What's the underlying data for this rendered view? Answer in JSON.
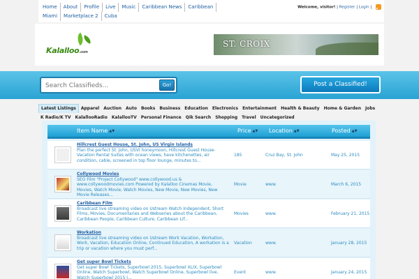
{
  "topnav": {
    "items": [
      "Home",
      "About",
      "Profile",
      "Live",
      "Music",
      "Caribbean News",
      "Caribbean",
      "Miami",
      "Marketplace 2",
      "Cuba"
    ]
  },
  "account": {
    "welcome": "Welcome, visitor!",
    "register": "Register",
    "login": "Login"
  },
  "header": {
    "logo_text": "Kalalloo",
    "logo_suffix": ".com",
    "banner_text": "ST. CROIX"
  },
  "search": {
    "placeholder": "Search Classifieds...",
    "go_label": "Go!",
    "post_label": "Post a Classified!"
  },
  "tabs": {
    "row1": [
      "Latest Listings",
      "Apparel",
      "Auction",
      "Auto",
      "Books",
      "Business",
      "Education",
      "Electronics",
      "Entertainment",
      "Health & Beauty",
      "Home & Garden",
      "Jobs"
    ],
    "row2": [
      "K Radio/K TV",
      "KalallooRadio",
      "KalallooTV",
      "Personal Finance",
      "Qik Search",
      "Shopping",
      "Travel",
      "Uncategorized"
    ]
  },
  "table": {
    "headers": {
      "name": "Item Name",
      "price": "Price",
      "location": "Location",
      "posted": "Posted"
    },
    "rows": [
      {
        "title": "Hillcrest Guest House, St. John, US Virgin Islands",
        "desc": "Plan the perfect St. John, USVI honeymoon, Hillcrest Guest House- Vacation Rental Suites with ocean views, have kitchenettes, air condition, cable, screened in top floor lounge, minutes to...",
        "price": "185",
        "location": "Cruz Bay, St. John",
        "posted": "May 25, 2015"
      },
      {
        "title": "Collywood Movies",
        "desc": "SEO Film \"Project Collywood\" www.collywood.us & www.collywoodmovies.com Powered by Kalalloo Cinemas Movie, Movies, Watch Movie, Watch Movies, New Movie, New Movies, New Movie Releases...",
        "price": "Movie",
        "location": "www.",
        "posted": "March 6, 2015"
      },
      {
        "title": "Caribbean Film",
        "desc": "Broadcast live streaming video on Ustream Watch Independent, Short Films, Movies, Documentaries and Webseries about the Caribbean, Caribbean People, Caribbean Culture, Caribbean Lif...",
        "price": "Movies",
        "location": "www.",
        "posted": "February 21, 2015"
      },
      {
        "title": "Workation",
        "desc": "Broadcast live streaming video on Ustream Work Vacation, Workation, Work, Vacation, Education Online, Continued Education, A workation is a trip or vacation where you must perf...",
        "price": "Vacation",
        "location": "www.",
        "posted": "January 28, 2015"
      },
      {
        "title": "Get super Bowl Tickets",
        "desc": "Get super Bowl Tickets, Superbowl 2015, Superbowl XLIX, Superbowl Online, Watch Superbowl, Watch Superbowl Online, Superbowl live, Watch Superbowl 2015 l...",
        "price": "Event",
        "location": "www.",
        "posted": "January 24, 2015"
      }
    ]
  },
  "colors": {
    "brand_blue": "#2aa3d3",
    "link_blue": "#1f5fa3"
  }
}
